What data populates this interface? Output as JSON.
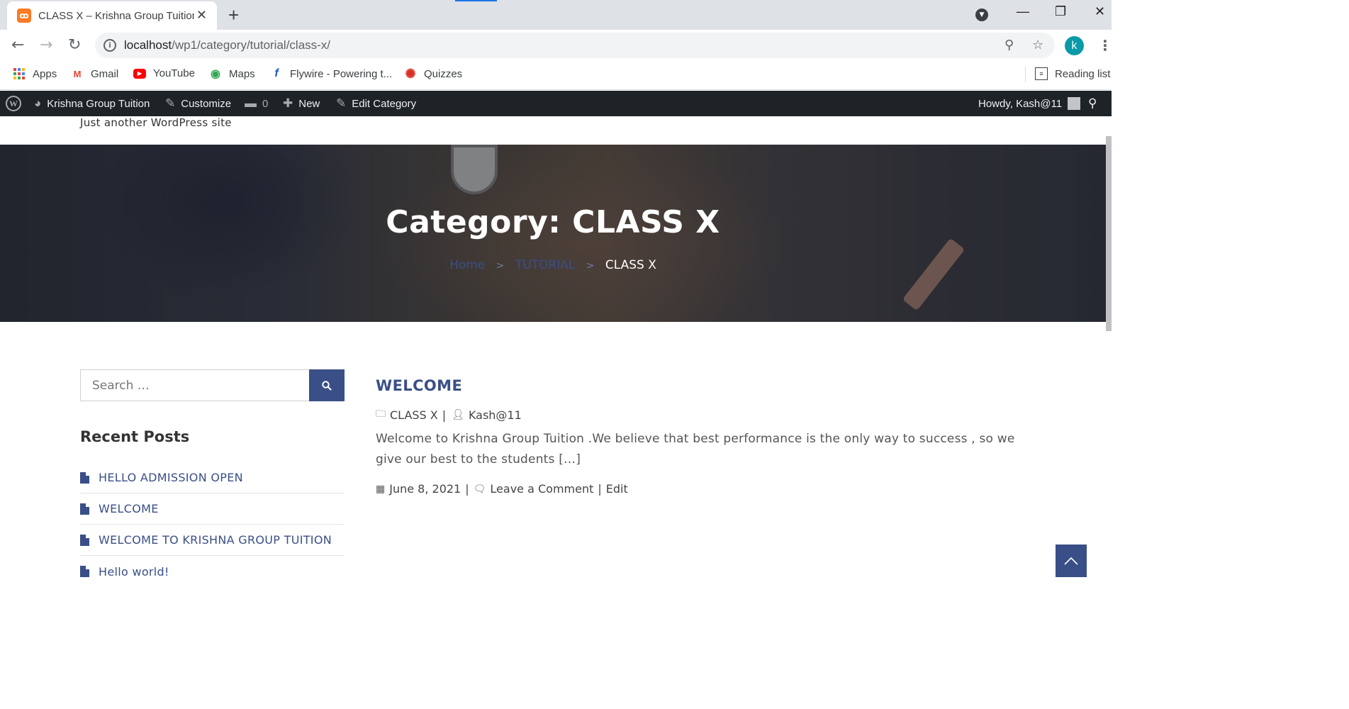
{
  "browser": {
    "tab": {
      "title": "CLASS X – Krishna Group Tuition",
      "favicon": "xampp-icon",
      "close": "✕"
    },
    "new_tab": "+",
    "window_controls": {
      "minimize": "—",
      "restore": "❐",
      "close": "✕"
    },
    "address": {
      "host": "localhost",
      "path": "/wp1/category/tutorial/class-x/"
    },
    "profile_initial": "k",
    "bookmarks": [
      {
        "label": "Apps",
        "icon": "apps-grid-icon"
      },
      {
        "label": "Gmail",
        "icon": "gmail-icon"
      },
      {
        "label": "YouTube",
        "icon": "youtube-icon"
      },
      {
        "label": "Maps",
        "icon": "maps-pin-icon"
      },
      {
        "label": "Flywire - Powering t...",
        "icon": "flywire-icon"
      },
      {
        "label": "Quizzes",
        "icon": "quizzes-icon"
      }
    ],
    "reading_list": "Reading list"
  },
  "admin_bar": {
    "site_name": "Krishna Group Tuition",
    "customize": "Customize",
    "comments_count": "0",
    "new": "New",
    "edit_category": "Edit Category",
    "howdy": "Howdy, Kash@11"
  },
  "site": {
    "tagline": "Just another WordPress site"
  },
  "hero": {
    "title": "Category: CLASS X",
    "breadcrumb": {
      "home": "Home",
      "parent": "TUTORIAL",
      "current": "CLASS X"
    }
  },
  "sidebar": {
    "search_placeholder": "Search …",
    "recent_title": "Recent Posts",
    "recent_posts": [
      "HELLO ADMISSION OPEN",
      "WELCOME",
      "WELCOME TO KRISHNA GROUP TUITION",
      "Hello world!"
    ]
  },
  "post": {
    "title": "WELCOME",
    "category": "CLASS X",
    "author": "Kash@11",
    "excerpt": "Welcome to Krishna Group Tuition .We believe that best performance is the only way to success , so we give our best to the students […]",
    "date": "June 8, 2021",
    "comment_link": "Leave a Comment",
    "edit_link": "Edit"
  },
  "colors": {
    "accent": "#3a4f87",
    "admin_bar": "#1d2327",
    "profile": "#0b9aa8"
  }
}
